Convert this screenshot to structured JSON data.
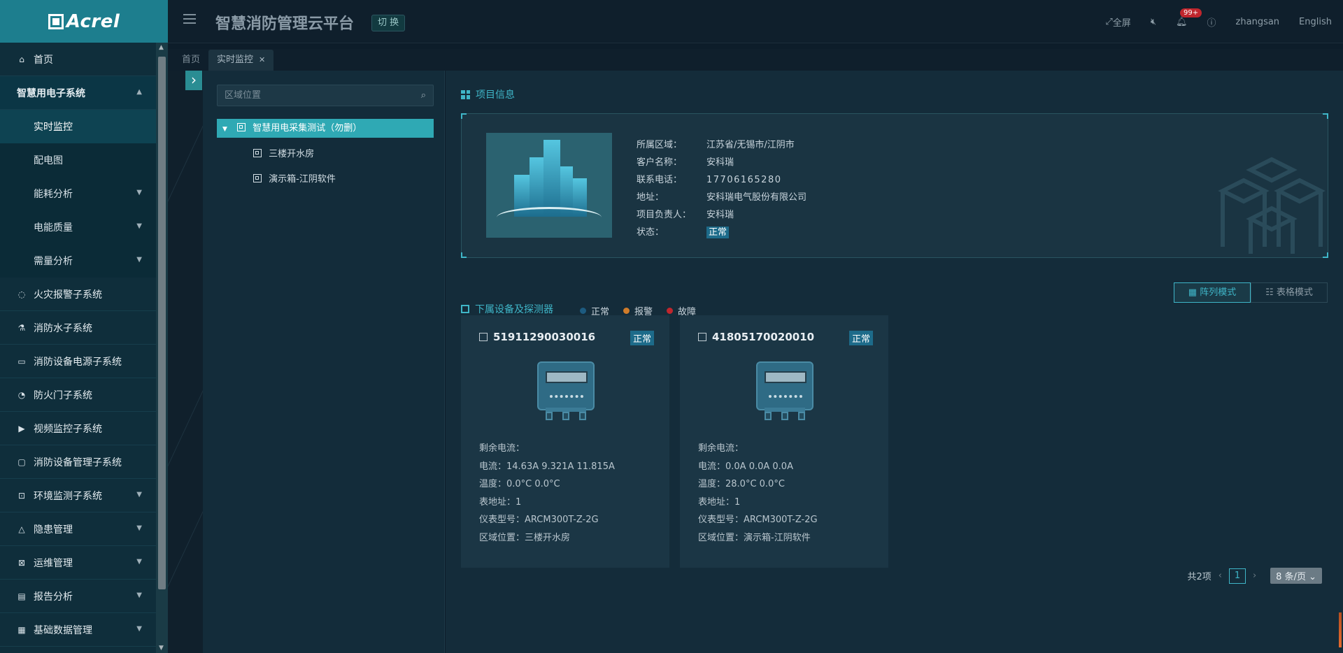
{
  "brand": {
    "logo_text": "Acrel"
  },
  "header": {
    "title": "智慧消防管理云平台",
    "switch_label": "切 换",
    "fullscreen_label": "全屏",
    "notification_count": "99+",
    "username": "zhangsan",
    "language": "English"
  },
  "tabs": [
    {
      "label": "首页"
    },
    {
      "label": "实时监控"
    }
  ],
  "sidebar": {
    "items": [
      {
        "label": "首页",
        "icon": "home-icon"
      },
      {
        "label": "智慧用电子系统",
        "icon": "",
        "open": true
      },
      {
        "label": "实时监控"
      },
      {
        "label": "配电图"
      },
      {
        "label": "能耗分析"
      },
      {
        "label": "电能质量"
      },
      {
        "label": "需量分析"
      },
      {
        "label": "火灾报警子系统",
        "icon": "fire-icon"
      },
      {
        "label": "消防水子系统",
        "icon": "flask-icon"
      },
      {
        "label": "消防设备电源子系统",
        "icon": "monitor-icon"
      },
      {
        "label": "防火门子系统",
        "icon": "bell-icon"
      },
      {
        "label": "视频监控子系统",
        "icon": "play-icon"
      },
      {
        "label": "消防设备管理子系统",
        "icon": "camera-icon"
      },
      {
        "label": "环境监测子系统",
        "icon": "lock-icon"
      },
      {
        "label": "隐患管理",
        "icon": "warning-icon"
      },
      {
        "label": "运维管理",
        "icon": "tool-icon"
      },
      {
        "label": "报告分析",
        "icon": "report-icon"
      },
      {
        "label": "基础数据管理",
        "icon": "data-icon"
      }
    ]
  },
  "tree": {
    "search_placeholder": "区域位置",
    "root": "智慧用电采集测试（勿删）",
    "children": [
      "三楼开水房",
      "演示箱-江阴软件"
    ]
  },
  "project": {
    "section_title": "项目信息",
    "fields": [
      {
        "k": "所属区域：",
        "v": "江苏省/无锡市/江阴市"
      },
      {
        "k": "客户名称：",
        "v": "安科瑞"
      },
      {
        "k": "联系电话：",
        "v": "17706165280"
      },
      {
        "k": "地址：",
        "v": "安科瑞电气股份有限公司"
      },
      {
        "k": "项目负责人：",
        "v": "安科瑞"
      },
      {
        "k": "状态：",
        "v": "正常"
      }
    ]
  },
  "devices": {
    "section_title": "下属设备及探测器",
    "legend": [
      {
        "label": "正常",
        "color": "#1d5b80"
      },
      {
        "label": "报警",
        "color": "#d07c2a"
      },
      {
        "label": "故障",
        "color": "#c0262d"
      }
    ],
    "mode_array": "阵列模式",
    "mode_table": "表格模式",
    "cards": [
      {
        "id": "51911290030016",
        "status": "正常",
        "params": [
          "剩余电流：",
          "电流：14.63A 9.321A 11.815A",
          "温度：0.0°C 0.0°C",
          "表地址：1",
          "仪表型号：ARCM300T-Z-2G",
          "区域位置：三楼开水房"
        ]
      },
      {
        "id": "41805170020010",
        "status": "正常",
        "params": [
          "剩余电流：",
          "电流：0.0A 0.0A 0.0A",
          "温度：28.0°C 0.0°C",
          "表地址：1",
          "仪表型号：ARCM300T-Z-2G",
          "区域位置：演示箱-江阴软件"
        ]
      }
    ]
  },
  "pagination": {
    "total": "共2项",
    "current": "1",
    "page_size": "8 条/页"
  }
}
